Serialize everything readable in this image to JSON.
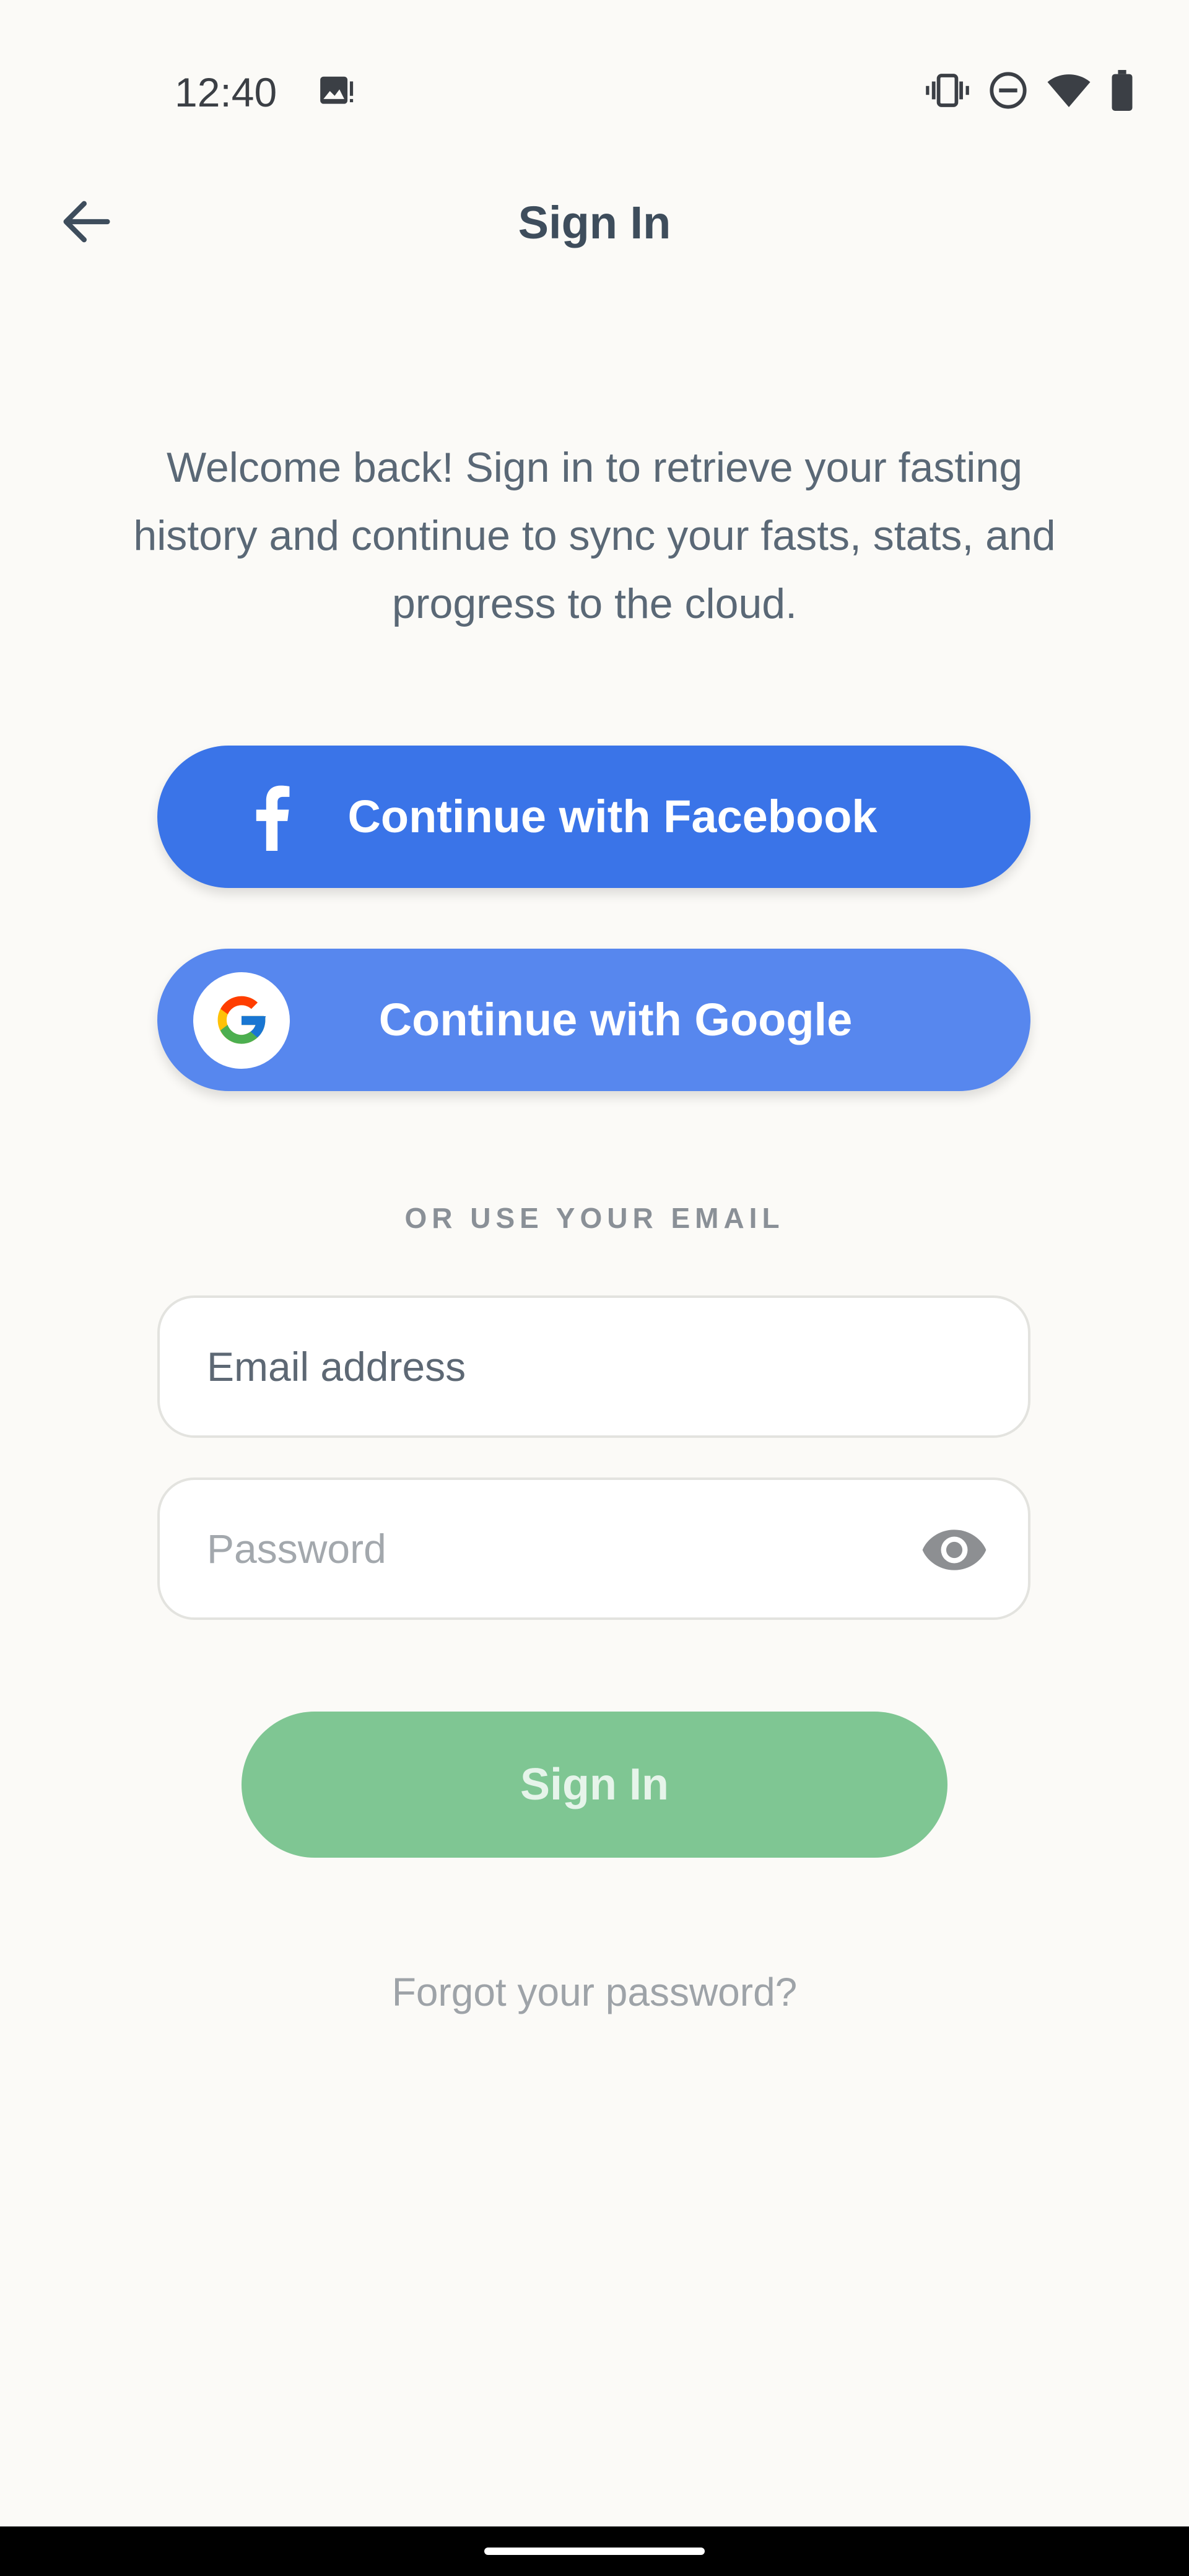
{
  "status_bar": {
    "time": "12:40",
    "icons": [
      "image-notification-icon",
      "vibrate-icon",
      "do-not-disturb-icon",
      "wifi-icon",
      "battery-icon"
    ]
  },
  "app_bar": {
    "back_icon": "arrow-left-icon",
    "title": "Sign In"
  },
  "intro": {
    "text": "Welcome back! Sign in to retrieve your fasting history and continue to sync your fasts, stats, and progress to the cloud."
  },
  "social": {
    "facebook_label": "Continue with Facebook",
    "google_label": "Continue with Google"
  },
  "divider": {
    "label": "OR USE YOUR EMAIL"
  },
  "form": {
    "email_placeholder": "Email address",
    "email_value": "",
    "password_placeholder": "Password",
    "password_value": ""
  },
  "actions": {
    "sign_in_label": "Sign In",
    "forgot_label": "Forgot your password?"
  },
  "colors": {
    "background": "#fbfaf7",
    "facebook_blue": "#3a74e8",
    "google_blue": "#5787ee",
    "sign_in_green": "#7fc693",
    "title_text": "#3e4d5c"
  }
}
